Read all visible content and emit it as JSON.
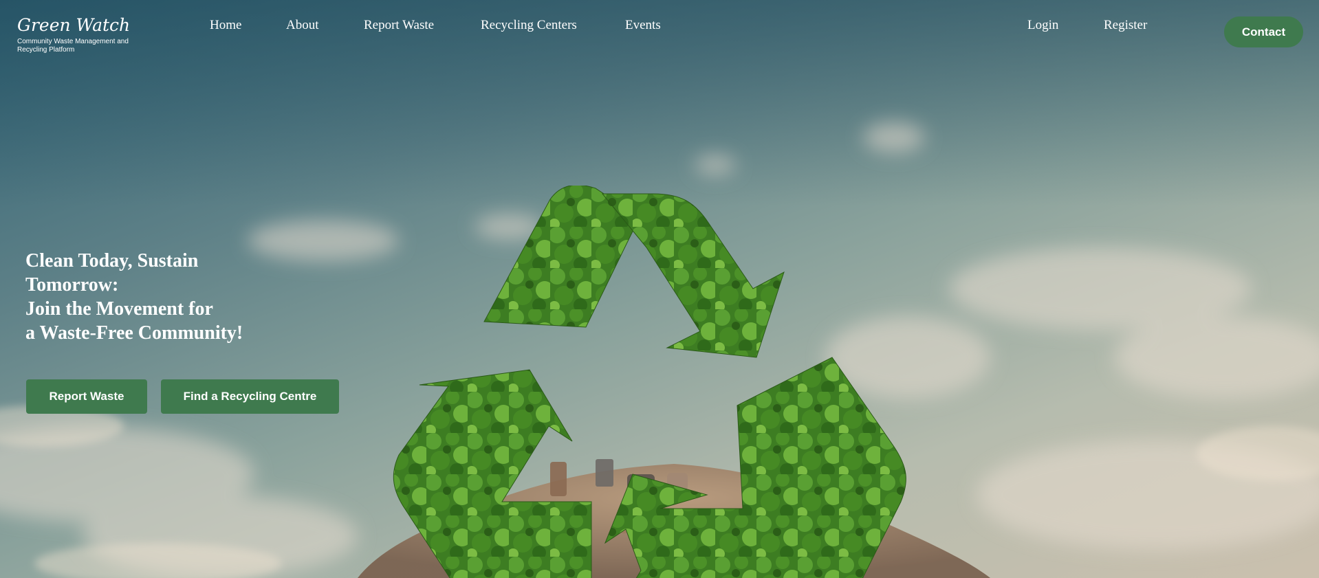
{
  "header": {
    "logo_title": "Green Watch",
    "logo_subtitle": "Community Waste Management and Recycling Platform",
    "nav": [
      {
        "label": "Home"
      },
      {
        "label": "About"
      },
      {
        "label": "Report Waste"
      },
      {
        "label": "Recycling Centers"
      },
      {
        "label": "Events"
      }
    ],
    "auth": {
      "login": "Login",
      "register": "Register"
    },
    "contact": "Contact"
  },
  "hero": {
    "heading_lines": [
      "Clean Today, Sustain",
      "Tomorrow:",
      "Join the Movement for",
      "a Waste-Free Community!"
    ],
    "buttons": {
      "report": "Report Waste",
      "find": "Find a Recycling Centre"
    },
    "icon": "recycle-symbol-icon"
  },
  "colors": {
    "accent": "#3f7a4e",
    "forest": "#3e8a2a",
    "sky_top": "#2f6173",
    "sky_bottom": "#cbc0ae"
  }
}
